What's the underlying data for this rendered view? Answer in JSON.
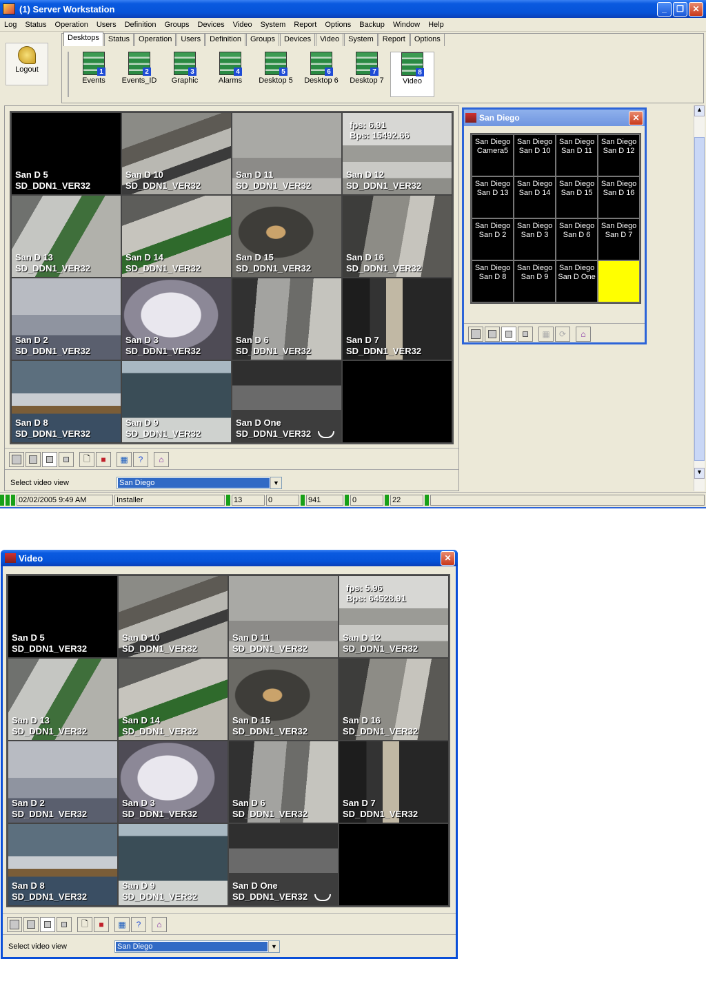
{
  "main_window": {
    "title": "(1)  Server Workstation",
    "menu": [
      "Log",
      "Status",
      "Operation",
      "Users",
      "Definition",
      "Groups",
      "Devices",
      "Video",
      "System",
      "Report",
      "Options",
      "Backup",
      "Window",
      "Help"
    ],
    "logout_label": "Logout",
    "tabs": [
      "Desktops",
      "Status",
      "Operation",
      "Users",
      "Definition",
      "Groups",
      "Devices",
      "Video",
      "System",
      "Report",
      "Options"
    ],
    "toolbar": [
      {
        "label": "Events",
        "num": "1"
      },
      {
        "label": "Events_ID",
        "num": "2"
      },
      {
        "label": "Graphic",
        "num": "3"
      },
      {
        "label": "Alarms",
        "num": "4"
      },
      {
        "label": "Desktop 5",
        "num": "5"
      },
      {
        "label": "Desktop 6",
        "num": "6"
      },
      {
        "label": "Desktop 7",
        "num": "7"
      },
      {
        "label": "Video",
        "num": "8"
      }
    ],
    "video": {
      "fps_label": "fps:  6.91",
      "bps_label": "Bps:  15492.66",
      "select_label": "Select video view",
      "select_value": "San Diego"
    },
    "status": {
      "datetime": "02/02/2005 9:49 AM",
      "user": "Installer",
      "f1": "13",
      "f2": "0",
      "f3": "941",
      "f4": "0",
      "f5": "22"
    }
  },
  "cameras": [
    {
      "name": "San D 5",
      "stream": "SD_DDN1_VER32"
    },
    {
      "name": "San D 10",
      "stream": "SD_DDN1_VER32"
    },
    {
      "name": "San D 11",
      "stream": "SD_DDN1_VER32"
    },
    {
      "name": "San D 12",
      "stream": "SD_DDN1_VER32"
    },
    {
      "name": "San D 13",
      "stream": "SD_DDN1_VER32"
    },
    {
      "name": "San D 14",
      "stream": "SD_DDN1_VER32"
    },
    {
      "name": "San D 15",
      "stream": "SD_DDN1_VER32"
    },
    {
      "name": "San D 16",
      "stream": "SD_DDN1_VER32"
    },
    {
      "name": "San D 2",
      "stream": "SD_DDN1_VER32"
    },
    {
      "name": "San D 3",
      "stream": "SD_DDN1_VER32"
    },
    {
      "name": "San D 6",
      "stream": "SD_DDN1_VER32"
    },
    {
      "name": "San D 7",
      "stream": "SD_DDN1_VER32"
    },
    {
      "name": "San D 8",
      "stream": "SD_DDN1_VER32"
    },
    {
      "name": "San D 9",
      "stream": "SD_DDN1_VER32"
    },
    {
      "name": "San D One",
      "stream": "SD_DDN1_VER32"
    },
    {
      "name": "",
      "stream": ""
    }
  ],
  "san_diego_panel": {
    "title": "San Diego",
    "cells": [
      [
        "San Diego",
        "Camera5"
      ],
      [
        "San Diego",
        "San D 10"
      ],
      [
        "San Diego",
        "San D 11"
      ],
      [
        "San Diego",
        "San D 12"
      ],
      [
        "San Diego",
        "San D 13"
      ],
      [
        "San Diego",
        "San D 14"
      ],
      [
        "San Diego",
        "San D 15"
      ],
      [
        "San Diego",
        "San D 16"
      ],
      [
        "San Diego",
        "San D 2"
      ],
      [
        "San Diego",
        "San D 3"
      ],
      [
        "San Diego",
        "San D 6"
      ],
      [
        "San Diego",
        "San D 7"
      ],
      [
        "San Diego",
        "San D 8"
      ],
      [
        "San Diego",
        "San D 9"
      ],
      [
        "San Diego",
        "San D One"
      ],
      [
        "",
        ""
      ]
    ]
  },
  "video_window": {
    "title": "Video",
    "fps_label": "fps:  5.96",
    "bps_label": "Bps:  64528.91",
    "select_label": "Select video view",
    "select_value": "San Diego"
  }
}
